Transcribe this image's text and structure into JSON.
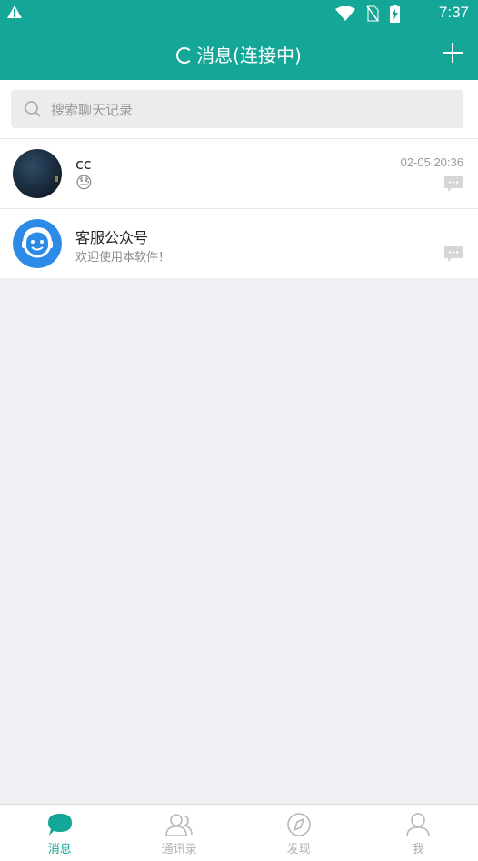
{
  "status_bar": {
    "time": "7:37"
  },
  "app_bar": {
    "title": "消息(连接中)"
  },
  "search": {
    "placeholder": "搜索聊天记录"
  },
  "conversations": [
    {
      "name": "cc",
      "preview_emoji": "😓",
      "time": "02-05 20:36"
    },
    {
      "name": "客服公众号",
      "preview": "欢迎使用本软件！",
      "time": ""
    }
  ],
  "tabs": [
    {
      "label": "消息",
      "active": true
    },
    {
      "label": "通讯录",
      "active": false
    },
    {
      "label": "发现",
      "active": false
    },
    {
      "label": "我",
      "active": false
    }
  ],
  "colors": {
    "primary": "#14a696",
    "background": "#efeff4",
    "accent_blue": "#2d8be8"
  }
}
